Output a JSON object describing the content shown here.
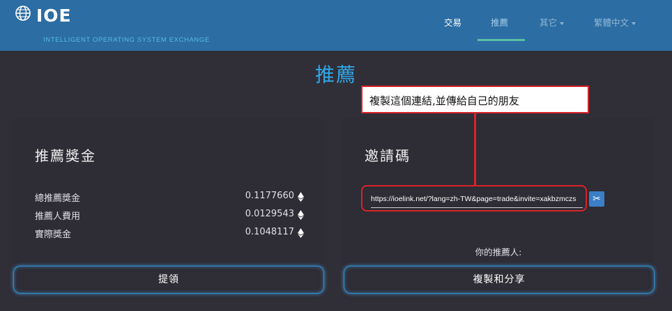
{
  "header": {
    "brand_name": "IOE",
    "brand_subtitle": "INTELLIGENT OPERATING SYSTEM EXCHANGE",
    "nav": {
      "trade": "交易",
      "referral": "推薦",
      "other": "其它",
      "language": "繁體中文"
    },
    "colors": {
      "bar": "#2c6da3",
      "active_underline": "#5bbfa3"
    }
  },
  "page_title": "推薦",
  "callout_text": "複製這個連結,並傳給自己的朋友",
  "help_icon": "?",
  "rewards_panel": {
    "title": "推薦獎金",
    "rows": [
      {
        "label": "總推薦獎金",
        "value": "0.1177660",
        "icon": "ethereum-icon"
      },
      {
        "label": "推薦人費用",
        "value": "0.0129543",
        "icon": "ethereum-icon"
      },
      {
        "label": "實際獎金",
        "value": "0.1048117",
        "icon": "ethereum-icon"
      }
    ],
    "button_label": "提領"
  },
  "invite_panel": {
    "title": "邀請碼",
    "link_value": "https://ioelink.net/?lang=zh-TW&page=trade&invite=xakbzmczs",
    "copy_icon": "scissors-icon",
    "referrer_label": "你的推薦人:",
    "button_label": "複製和分享"
  },
  "colors": {
    "background": "#302e37",
    "accent": "#2fa8e8",
    "annotation": "#d8232a"
  }
}
